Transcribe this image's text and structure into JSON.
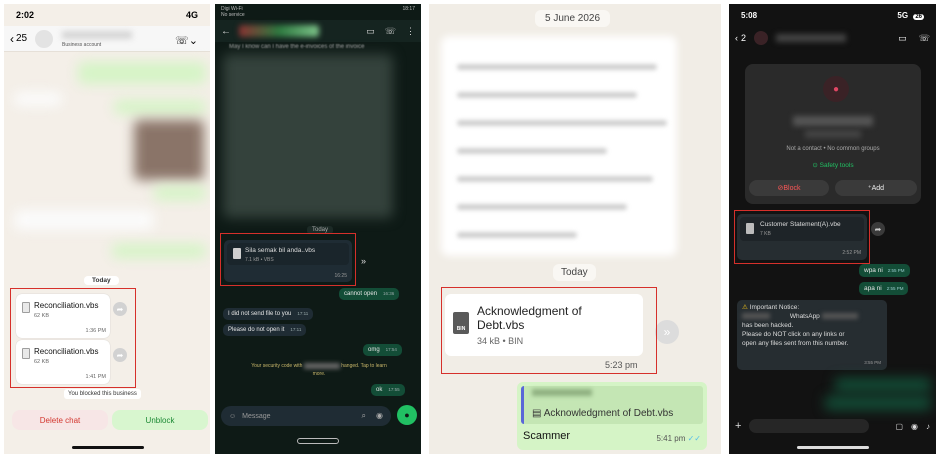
{
  "panel1": {
    "status_time": "2:02",
    "status_net": "4G",
    "back_count": "25",
    "contact_sub": "Business account",
    "date_chip": "Today",
    "files": [
      {
        "name": "Reconciliation.vbs",
        "size": "62 KB",
        "time": "1:36 PM"
      },
      {
        "name": "Reconciliation.vbs",
        "size": "62 KB",
        "time": "1:41 PM"
      }
    ],
    "blocked_notice": "You blocked this business",
    "delete_label": "Delete chat",
    "unblock_label": "Unblock"
  },
  "panel2": {
    "status_left": "Digi Wi-Fi",
    "status_sub": "No service",
    "status_time": "18:17",
    "partial_text": "May I know can I have the e-invoices of the invoice",
    "date_chip": "Today",
    "file": {
      "name": "Sila semak bil anda..vbs",
      "size": "7.1 kB • VBS",
      "time": "16:25"
    },
    "messages": [
      {
        "text": "cannot open",
        "time": "16:36",
        "dir": "out"
      },
      {
        "text": "I did not send file to you",
        "time": "17:11",
        "dir": "in"
      },
      {
        "text": "Please do not open it",
        "time": "17:11",
        "dir": "in"
      },
      {
        "text": "omg",
        "time": "17:54",
        "dir": "out"
      },
      {
        "text": "ok",
        "time": "17:55",
        "dir": "out"
      }
    ],
    "security_note_a": "Your security code with",
    "security_note_b": "hanged. Tap to learn",
    "security_note_c": "more.",
    "input_placeholder": "Message"
  },
  "panel3": {
    "date_chip": "5 June 2026",
    "today_chip": "Today",
    "file": {
      "name": "Acknowledgment of Debt.vbs",
      "size": "34 kB • BIN",
      "time": "5:23 pm",
      "icon_label": "BIN"
    },
    "reply": {
      "quoted_file": "Acknowledgment of Debt.vbs",
      "text": "Scammer",
      "time": "5:41 pm"
    }
  },
  "panel4": {
    "status_time": "5:08",
    "status_net": "5G",
    "status_batt": "26",
    "back_count": "2",
    "not_contact": "Not a contact • No common groups",
    "safety_tools": "Safety tools",
    "block_label": "Block",
    "add_label": "Add",
    "file": {
      "name": "Customer Statement(A).vbe",
      "size": "7 KB",
      "time": "2:52 PM"
    },
    "messages": [
      {
        "text": "wpa ni",
        "time": "2:55 PM"
      },
      {
        "text": "apa ni",
        "time": "2:55 PM"
      }
    ],
    "notice": {
      "title": "Important Notice:",
      "line2": "WhatsApp",
      "line3": "has been hacked.",
      "line4": "Please do NOT click on any links or",
      "line5": "open any files sent from this number.",
      "time": "3:55 PM"
    }
  },
  "colors": {
    "alert_red": "#d6302b",
    "wa_green": "#21c063",
    "bubble_green": "#d5f4c6"
  }
}
